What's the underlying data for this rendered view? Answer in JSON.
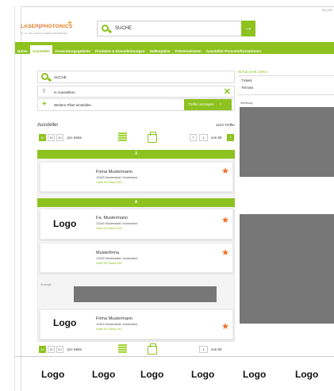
{
  "header": {
    "lang": "De | En",
    "logo_main_1": "LASER",
    "logo_main_2": "PHOTONICS",
    "logo_cross": "+",
    "logo_sub": "W · M · BAU 2025 PLANERS WELTMESSE",
    "search_label": "SUCHE",
    "search_icon": "search-icon",
    "search_button_icon": "arrow-right-icon",
    "search_button_glyph": "→"
  },
  "nav": {
    "items": [
      "Home",
      "Aussteller",
      "Anwendungsgebiete",
      "Produkte & Dienstleistungen",
      "Hallenpläne",
      "Präsentationen",
      "Aussteller-Presseinformationen"
    ],
    "active_index": 1
  },
  "search_panel": {
    "input_value": "SUCHE",
    "filter_label": "in Ausstellern",
    "more_filters_label": "Weitere Filter einstellen",
    "show_results_label": "Treffer anzeigen",
    "show_results_glyph": "›"
  },
  "list": {
    "title": "Aussteller",
    "count": "1244 Treffer",
    "per_page": [
      "10",
      "30",
      "50"
    ],
    "per_page_label": "pro Seite",
    "page_value": "1",
    "page_of": "von 60",
    "prev_glyph": "‹",
    "next_glyph": "›"
  },
  "groups": [
    {
      "letter": "3",
      "entries": [
        {
          "logo": "",
          "name": "Firma Mustermann",
          "address": "12345 Musterstadt, Musterland",
          "booth": "Halle A3 Stand 150"
        }
      ]
    },
    {
      "letter": "A",
      "entries": [
        {
          "logo": "Logo",
          "name": "Fa. Mustermann",
          "address": "12345 Musterstadt, Musterland",
          "booth": "Halle A3 Stand 333"
        },
        {
          "logo": "",
          "name": "Musterfirma",
          "address": "12345 Musterstadt, Musterland",
          "booth": "Halle A3 Stand 335"
        }
      ]
    }
  ],
  "ad": {
    "label": "Anzeige"
  },
  "last_entry": {
    "logo": "Logo",
    "name": "Firma Mustermann",
    "address": "12345 Musterstadt, Musterland",
    "booth": "Halle A3 Stand 150"
  },
  "bottom_pager": {
    "per_page": [
      "10",
      "30",
      "50"
    ],
    "per_page_label": "pro Seite",
    "page_value": "1",
    "page_of": "von 60"
  },
  "favorite_glyph": "★",
  "filter_glyph": "⊽",
  "close_glyph": "✕",
  "plus_glyph": "+",
  "sidebar": {
    "title": "NÜTZLICHE LINKS",
    "links": [
      "Tickets",
      "Termine"
    ],
    "link_bullet": "›",
    "video_label": "Werbung"
  },
  "bottom_logos": [
    "Logo",
    "Logo",
    "Logo",
    "Logo",
    "Logo",
    "Logo"
  ],
  "colors": {
    "accent": "#8dc21f",
    "star": "#f26b21",
    "placeholder_gray": "#777777"
  }
}
